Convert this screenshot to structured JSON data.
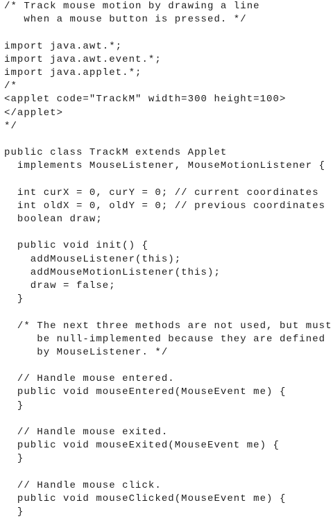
{
  "code": {
    "lines": [
      "/* Track mouse motion by drawing a line",
      "   when a mouse button is pressed. */",
      "",
      "import java.awt.*;",
      "import java.awt.event.*;",
      "import java.applet.*;",
      "/*",
      "<applet code=\"TrackM\" width=300 height=100>",
      "</applet>",
      "*/",
      "",
      "public class TrackM extends Applet",
      "  implements MouseListener, MouseMotionListener {",
      "",
      "  int curX = 0, curY = 0; // current coordinates",
      "  int oldX = 0, oldY = 0; // previous coordinates",
      "  boolean draw;",
      "",
      "  public void init() {",
      "    addMouseListener(this);",
      "    addMouseMotionListener(this);",
      "    draw = false;",
      "  }",
      "",
      "  /* The next three methods are not used, but must",
      "     be null-implemented because they are defined",
      "     by MouseListener. */",
      "",
      "  // Handle mouse entered.",
      "  public void mouseEntered(MouseEvent me) {",
      "  }",
      "",
      "  // Handle mouse exited.",
      "  public void mouseExited(MouseEvent me) {",
      "  }",
      "",
      "  // Handle mouse click.",
      "  public void mouseClicked(MouseEvent me) {",
      "  }"
    ]
  }
}
